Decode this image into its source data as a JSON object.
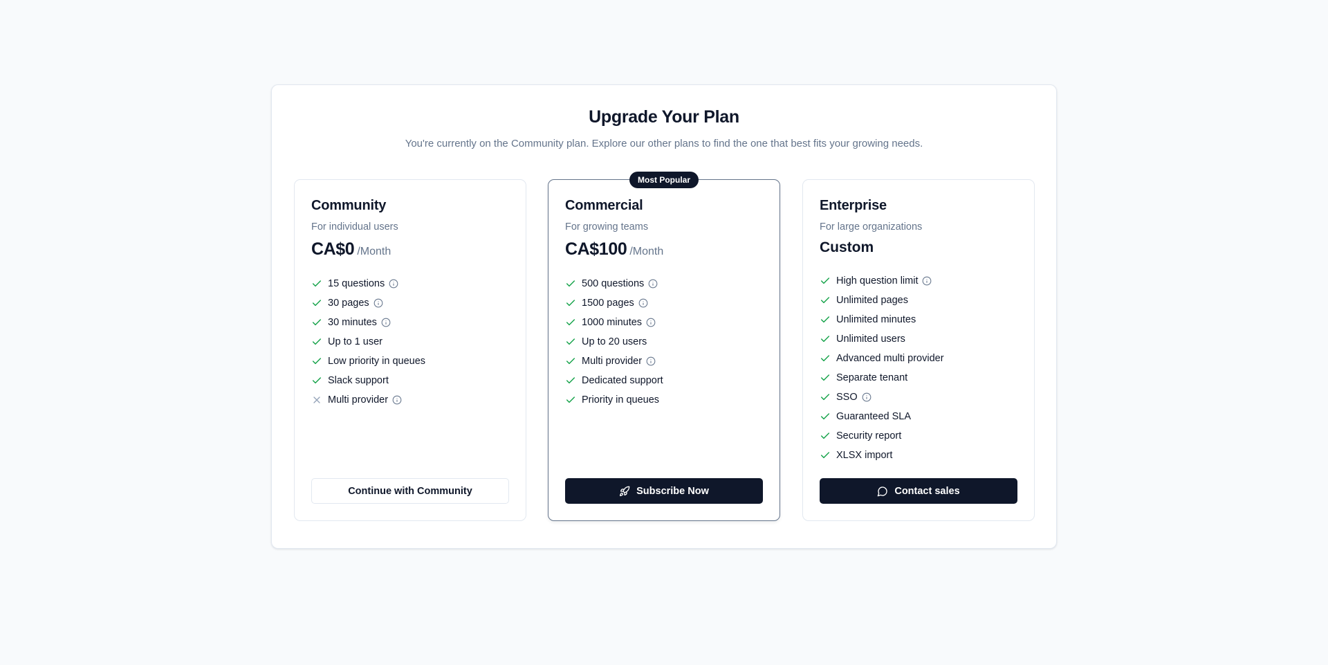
{
  "dialog": {
    "title": "Upgrade Your Plan",
    "subtitle": "You're currently on the Community plan. Explore our other plans to find the one that best fits your growing needs."
  },
  "colors": {
    "check": "#16a34a",
    "cross": "#94a3b8",
    "info": "#64748b",
    "primary": "#0f172a"
  },
  "plans": [
    {
      "name": "Community",
      "description": "For individual users",
      "price": "CA$0",
      "period": "/Month",
      "features": [
        {
          "label": "15 questions",
          "included": true,
          "info": true
        },
        {
          "label": "30 pages",
          "included": true,
          "info": true
        },
        {
          "label": "30 minutes",
          "included": true,
          "info": true
        },
        {
          "label": "Up to 1 user",
          "included": true,
          "info": false
        },
        {
          "label": "Low priority in queues",
          "included": true,
          "info": false
        },
        {
          "label": "Slack support",
          "included": true,
          "info": false
        },
        {
          "label": "Multi provider",
          "included": false,
          "info": true
        }
      ],
      "button": {
        "label": "Continue with Community",
        "icon": null
      }
    },
    {
      "name": "Commercial",
      "badge": "Most Popular",
      "description": "For growing teams",
      "price": "CA$100",
      "period": "/Month",
      "features": [
        {
          "label": "500 questions",
          "included": true,
          "info": true
        },
        {
          "label": "1500 pages",
          "included": true,
          "info": true
        },
        {
          "label": "1000 minutes",
          "included": true,
          "info": true
        },
        {
          "label": "Up to 20 users",
          "included": true,
          "info": false
        },
        {
          "label": "Multi provider",
          "included": true,
          "info": true
        },
        {
          "label": "Dedicated support",
          "included": true,
          "info": false
        },
        {
          "label": "Priority in queues",
          "included": true,
          "info": false
        }
      ],
      "button": {
        "label": "Subscribe Now",
        "icon": "rocket-icon"
      }
    },
    {
      "name": "Enterprise",
      "description": "For large organizations",
      "price": "Custom",
      "features": [
        {
          "label": "High question limit",
          "included": true,
          "info": true
        },
        {
          "label": "Unlimited pages",
          "included": true,
          "info": false
        },
        {
          "label": "Unlimited minutes",
          "included": true,
          "info": false
        },
        {
          "label": "Unlimited users",
          "included": true,
          "info": false
        },
        {
          "label": "Advanced multi provider",
          "included": true,
          "info": false
        },
        {
          "label": "Separate tenant",
          "included": true,
          "info": false
        },
        {
          "label": "SSO",
          "included": true,
          "info": true
        },
        {
          "label": "Guaranteed SLA",
          "included": true,
          "info": false
        },
        {
          "label": "Security report",
          "included": true,
          "info": false
        },
        {
          "label": "XLSX import",
          "included": true,
          "info": false
        }
      ],
      "button": {
        "label": "Contact sales",
        "icon": "message-circle-icon"
      }
    }
  ]
}
